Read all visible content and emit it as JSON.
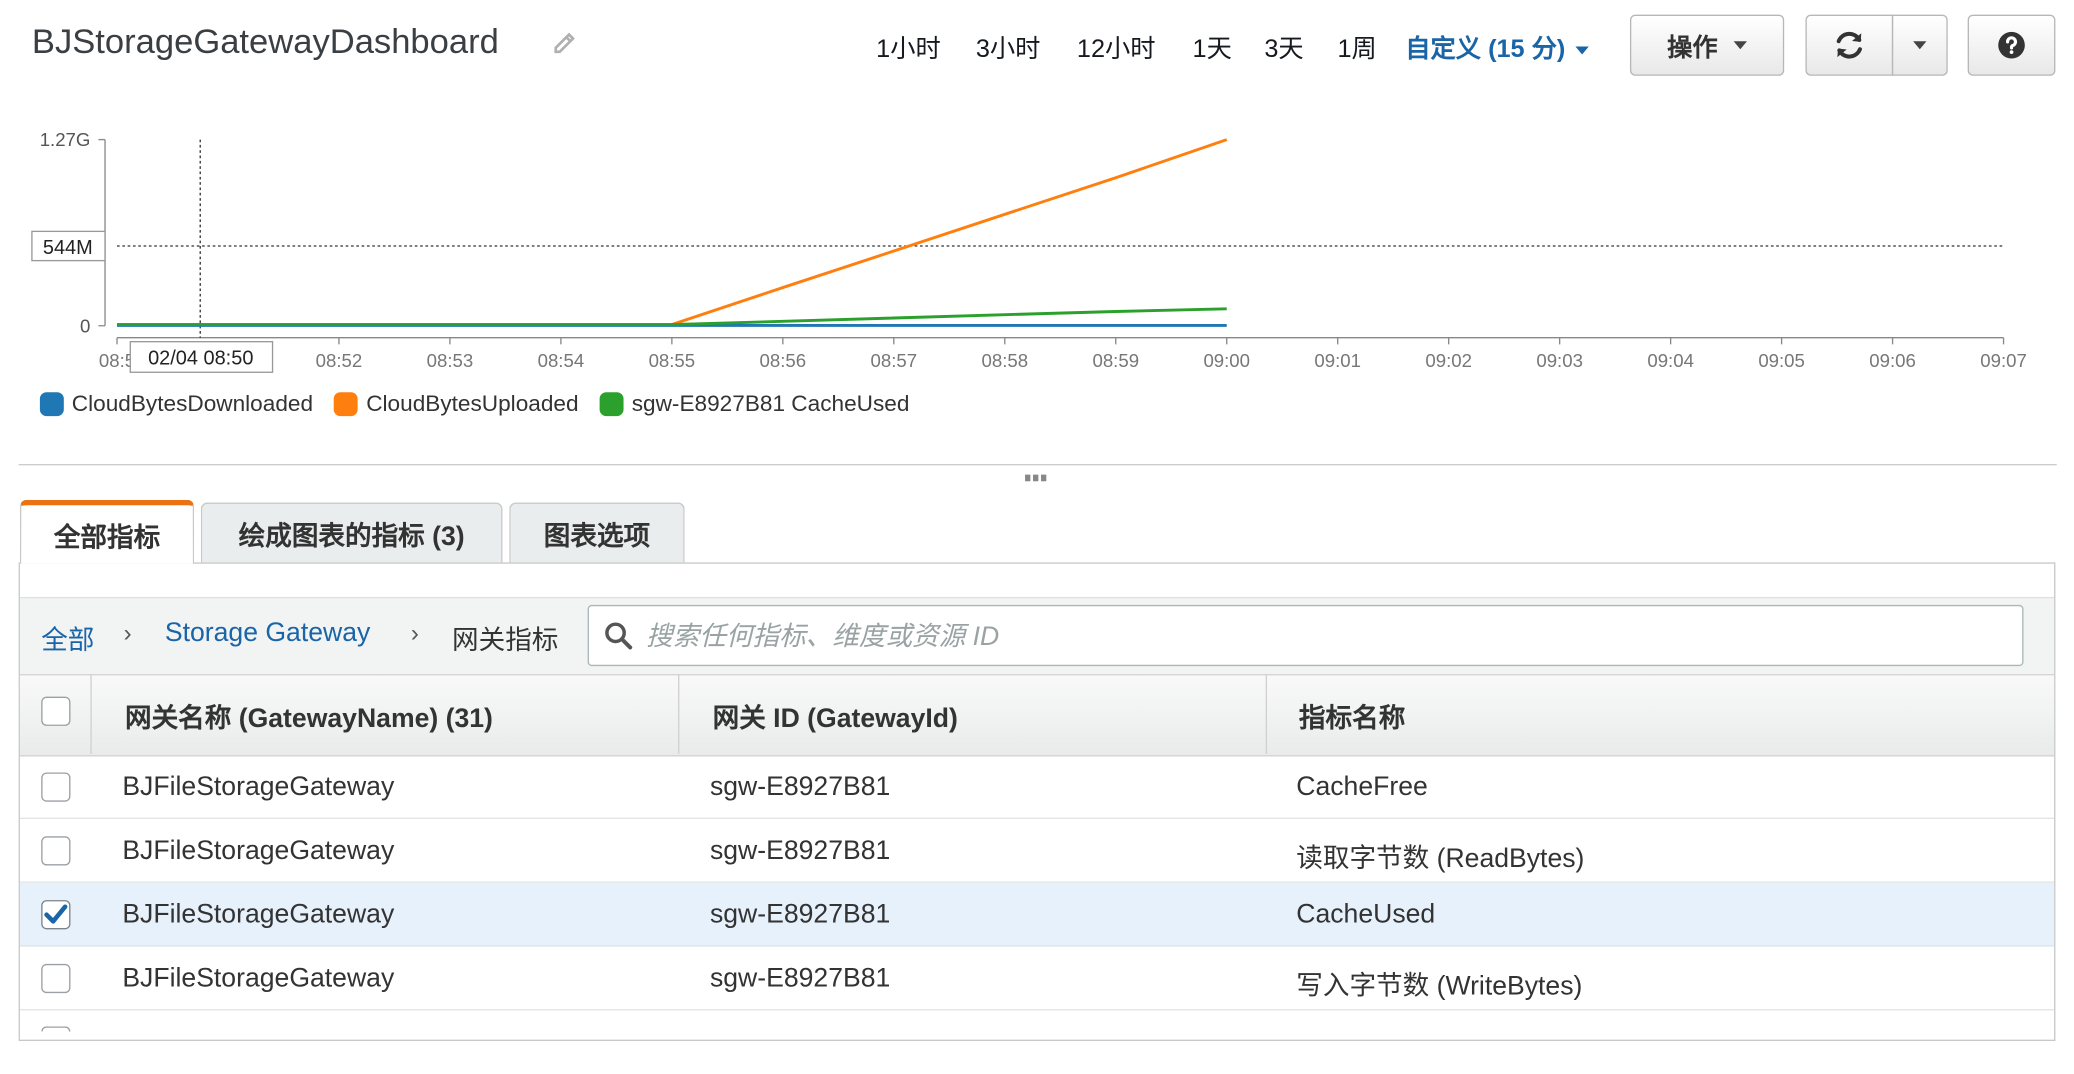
{
  "header": {
    "title": "BJStorageGatewayDashboard",
    "time_ranges": [
      "1小时",
      "3小时",
      "12小时",
      "1天",
      "3天",
      "1周"
    ],
    "custom_range": "自定义 (15 分)",
    "actions_label": "操作"
  },
  "chart_data": {
    "type": "line",
    "y_ticks": [
      "0",
      "1.27G"
    ],
    "x_ticks": [
      "08:5",
      "08:52",
      "08:53",
      "08:54",
      "08:55",
      "08:56",
      "08:57",
      "08:58",
      "08:59",
      "09:00",
      "09:01",
      "09:02",
      "09:03",
      "09:04",
      "09:05",
      "09:06",
      "09:07"
    ],
    "y_range_bytes": [
      0,
      1270000000
    ],
    "crosshair": {
      "time_label": "02/04 08:50",
      "value_label": "544M",
      "value_bytes": 544000000
    },
    "legend_placement": "bottom-left",
    "series": [
      {
        "name": "CloudBytesDownloaded",
        "color": "#1f77b4",
        "x": [
          "08:50",
          "08:51",
          "08:52",
          "08:53",
          "08:54",
          "08:55",
          "08:56",
          "08:57",
          "08:58",
          "08:59",
          "09:00"
        ],
        "values": [
          2000000,
          2000000,
          2000000,
          2000000,
          2000000,
          2000000,
          2000000,
          2000000,
          2000000,
          2000000,
          2000000
        ]
      },
      {
        "name": "CloudBytesUploaded",
        "color": "#ff7f0e",
        "x": [
          "08:50",
          "08:51",
          "08:52",
          "08:53",
          "08:54",
          "08:55",
          "08:56",
          "08:57",
          "08:58",
          "08:59",
          "09:00"
        ],
        "values": [
          8000000,
          8000000,
          8000000,
          8000000,
          8000000,
          8000000,
          260000000,
          510000000,
          760000000,
          1010000000,
          1270000000
        ]
      },
      {
        "name": "sgw-E8927B81 CacheUsed",
        "color": "#2ca02c",
        "x": [
          "08:50",
          "08:51",
          "08:52",
          "08:53",
          "08:54",
          "08:55",
          "08:56",
          "08:57",
          "08:58",
          "08:59",
          "09:00"
        ],
        "values": [
          8000000,
          8000000,
          8000000,
          8000000,
          8000000,
          8000000,
          30000000,
          53000000,
          75000000,
          97000000,
          115000000
        ]
      }
    ]
  },
  "tabs": [
    {
      "label": "全部指标",
      "active": true
    },
    {
      "label": "绘成图表的指标 (3)",
      "active": false
    },
    {
      "label": "图表选项",
      "active": false
    }
  ],
  "breadcrumb": {
    "root": "全部",
    "service": "Storage Gateway",
    "current": "网关指标"
  },
  "search": {
    "placeholder": "搜索任何指标、维度或资源 ID",
    "value": ""
  },
  "table": {
    "columns": [
      "网关名称 (GatewayName) (31)",
      "网关 ID (GatewayId)",
      "指标名称"
    ],
    "rows": [
      {
        "gateway_name": "BJFileStorageGateway",
        "gateway_id": "sgw-E8927B81",
        "metric": "CacheFree",
        "checked": false
      },
      {
        "gateway_name": "BJFileStorageGateway",
        "gateway_id": "sgw-E8927B81",
        "metric": "读取字节数 (ReadBytes)",
        "checked": false
      },
      {
        "gateway_name": "BJFileStorageGateway",
        "gateway_id": "sgw-E8927B81",
        "metric": "CacheUsed",
        "checked": true
      },
      {
        "gateway_name": "BJFileStorageGateway",
        "gateway_id": "sgw-E8927B81",
        "metric": "写入字节数 (WriteBytes)",
        "checked": false
      }
    ]
  },
  "colors": {
    "accent": "#1a64a8",
    "active_tab": "#ec7211",
    "selected_row": "#e7f1fb"
  }
}
